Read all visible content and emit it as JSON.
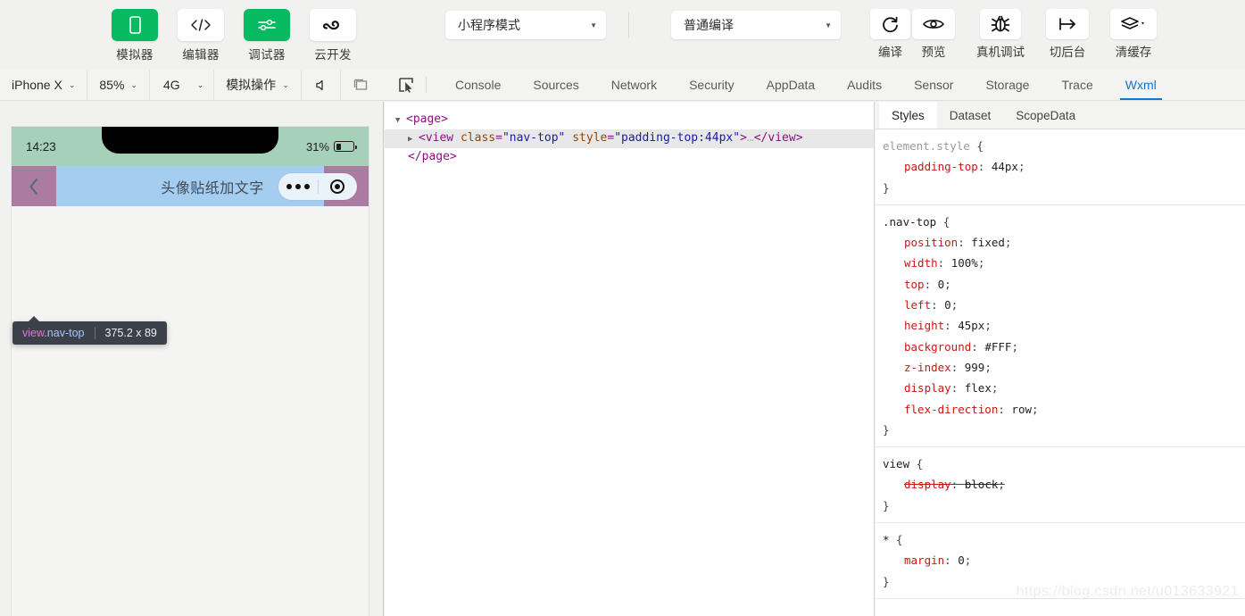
{
  "toolbar": {
    "avatar_name": "user-avatar",
    "buttons": [
      {
        "label": "模拟器",
        "icon": "phone-icon",
        "style": "green"
      },
      {
        "label": "编辑器",
        "icon": "code-icon",
        "style": "white"
      },
      {
        "label": "调试器",
        "icon": "sliders-icon",
        "style": "green"
      },
      {
        "label": "云开发",
        "icon": "cloud-loop-icon",
        "style": "white"
      }
    ],
    "mode_select": {
      "value": "小程序模式",
      "caret": "▼"
    },
    "compile_select": {
      "value": "普通编译",
      "caret": "▼"
    },
    "actions": [
      {
        "label": "编译",
        "icon": "refresh-icon"
      },
      {
        "label": "预览",
        "icon": "eye-icon"
      },
      {
        "label": "真机调试",
        "icon": "bug-icon"
      },
      {
        "label": "切后台",
        "icon": "background-switch-icon"
      },
      {
        "label": "清缓存",
        "icon": "layers-icon",
        "caret": "▼"
      }
    ]
  },
  "subbar": {
    "device": {
      "value": "iPhone X",
      "caret": "⌄"
    },
    "zoom": {
      "value": "85%",
      "caret": "⌄"
    },
    "network": {
      "value": "4G",
      "caret": "⌄"
    },
    "simulate": {
      "value": "模拟操作",
      "caret": "⌄"
    },
    "mute_icon": "speaker-icon",
    "window_icon": "window-icon",
    "inspect_icon": "inspect-element-icon",
    "devtools_tabs": [
      {
        "label": "Console",
        "active": false
      },
      {
        "label": "Sources",
        "active": false
      },
      {
        "label": "Network",
        "active": false
      },
      {
        "label": "Security",
        "active": false
      },
      {
        "label": "AppData",
        "active": false
      },
      {
        "label": "Audits",
        "active": false
      },
      {
        "label": "Sensor",
        "active": false
      },
      {
        "label": "Storage",
        "active": false
      },
      {
        "label": "Trace",
        "active": false
      },
      {
        "label": "Wxml",
        "active": true
      }
    ]
  },
  "simulator": {
    "status_bar": {
      "time": "14:23",
      "battery_percent": "31%"
    },
    "nav_bar": {
      "title": "头像贴纸加文字",
      "back_icon": "chevron-left-icon"
    },
    "capsule": {
      "more_icon": "more-dots-icon",
      "target_icon": "target-icon"
    },
    "tooltip": {
      "tag": "view",
      "class": ".nav-top",
      "size": "375.2 x 89"
    },
    "overlay_colors": {
      "padding": "#a6d0b9",
      "margin": "#ab7ba2",
      "content": "#a5cdef"
    }
  },
  "wxml": {
    "lines": [
      {
        "indent": 0,
        "arrow": "▼",
        "text": "<page>",
        "selected": false
      },
      {
        "indent": 1,
        "arrow": "▶",
        "text": "<view class=\"nav-top\" style=\"padding-top:44px\">…</view>",
        "selected": true
      },
      {
        "indent": 0,
        "arrow": "",
        "text": "</page>",
        "selected": false
      }
    ],
    "tag_open": "<page>",
    "tag_close": "</page>",
    "child_tag": "view",
    "child_attr_class_name": "class",
    "child_attr_class_value": "\"nav-top\"",
    "child_attr_style_name": "style",
    "child_attr_style_value": "\"padding-top:44px\"",
    "child_close": "</view>",
    "ellipsis": "…"
  },
  "styles": {
    "tabs": [
      {
        "label": "Styles",
        "active": true
      },
      {
        "label": "Dataset",
        "active": false
      },
      {
        "label": "ScopeData",
        "active": false
      }
    ],
    "rules": [
      {
        "selector": "element.style",
        "selector_kind": "element",
        "declarations": [
          {
            "prop": "padding-top",
            "value": "44px",
            "struck": false
          }
        ]
      },
      {
        "selector": ".nav-top",
        "selector_kind": "class",
        "declarations": [
          {
            "prop": "position",
            "value": "fixed",
            "struck": false
          },
          {
            "prop": "width",
            "value": "100%",
            "struck": false
          },
          {
            "prop": "top",
            "value": "0",
            "struck": false
          },
          {
            "prop": "left",
            "value": "0",
            "struck": false
          },
          {
            "prop": "height",
            "value": "45px",
            "struck": false
          },
          {
            "prop": "background",
            "value": "#FFF",
            "struck": false
          },
          {
            "prop": "z-index",
            "value": "999",
            "struck": false
          },
          {
            "prop": "display",
            "value": "flex",
            "struck": false
          },
          {
            "prop": "flex-direction",
            "value": "row",
            "struck": false
          }
        ]
      },
      {
        "selector": "view",
        "selector_kind": "type",
        "declarations": [
          {
            "prop": "display",
            "value": "block",
            "struck": true
          }
        ]
      },
      {
        "selector": "*",
        "selector_kind": "universal",
        "declarations": [
          {
            "prop": "margin",
            "value": "0",
            "struck": false
          }
        ]
      }
    ]
  },
  "watermark": "https://blog.csdn.net/u013633921",
  "accent_colors": {
    "green": "#07b961",
    "tab_active_blue": "#1a73c8",
    "tooltip_bg": "#3b4049"
  }
}
